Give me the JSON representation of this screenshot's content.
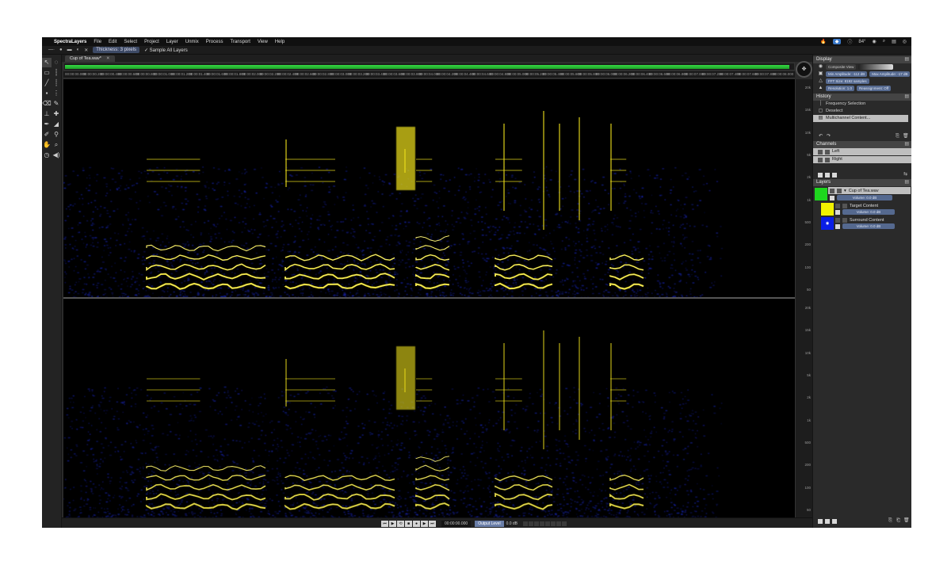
{
  "menubar": {
    "app_name": "SpectraLayers",
    "items": [
      "File",
      "Edit",
      "Select",
      "Project",
      "Layer",
      "Unmix",
      "Process",
      "Transport",
      "View",
      "Help"
    ],
    "tray_value": "84°"
  },
  "optbar": {
    "thickness_label": "Thickness: 3 pixels",
    "sample_all_label": "Sample All Layers"
  },
  "document": {
    "tab_label": "Cup of Tea.wav*",
    "overview_fraction": 0.995
  },
  "ruler": {
    "ticks": [
      "00:00:00.000",
      "00:00:00.200",
      "00:00:00.400",
      "00:00:00.600",
      "00:00:00.800",
      "00:00:01.000",
      "00:00:01.200",
      "00:00:01.400",
      "00:00:01.600",
      "00:00:01.800",
      "00:00:02.000",
      "00:00:02.200",
      "00:00:02.400",
      "00:00:02.600",
      "00:00:02.800",
      "00:00:03.000",
      "00:00:03.200",
      "00:00:03.400",
      "00:00:03.600",
      "00:00:03.800",
      "00:00:04.000",
      "00:00:04.200",
      "00:00:04.400",
      "00:00:04.600",
      "00:00:04.800",
      "00:00:05.000",
      "00:00:05.200",
      "00:00:05.400",
      "00:00:05.600",
      "00:00:05.800",
      "00:00:06.000",
      "00:00:06.200",
      "00:00:06.400",
      "00:00:06.600",
      "00:00:06.800",
      "00:00:07.000",
      "00:00:07.200",
      "00:00:07.400",
      "00:00:07.600",
      "00:00:07.800",
      "00:00:08.000"
    ]
  },
  "freqscale": {
    "top_labels": [
      "20k",
      "15k",
      "10k",
      "5k",
      "2k",
      "1k",
      "500",
      "200",
      "100",
      "50"
    ],
    "bottom_labels": [
      "20k",
      "15k",
      "10k",
      "5k",
      "2k",
      "1k",
      "500",
      "200",
      "100",
      "50"
    ]
  },
  "transport": {
    "buttons": [
      "⏮",
      "▶",
      "⟲",
      "■",
      "●",
      "▶",
      "⏭"
    ],
    "time": "00:00:00.000",
    "output_label": "Output Level",
    "output_db": "0.0 dB"
  },
  "panels": {
    "display": {
      "title": "Display",
      "composite_view": "Composite View",
      "min_amp": "Min Amplitude: -112 dB",
      "max_amp": "Max Amplitude: -17 dB",
      "fft": "FFT Size: 8192 samples",
      "resolution": "Resolution: 1.0",
      "reassign": "Reassignment: Off"
    },
    "history": {
      "title": "History",
      "items": [
        "Frequency Selection",
        "Deselect",
        "Multichannel Content..."
      ]
    },
    "channels": {
      "title": "Channels",
      "items": [
        "Left",
        "Right"
      ]
    },
    "layers": {
      "title": "Layers",
      "items": [
        {
          "name": "Cup of Tea.wav",
          "volume": "Volume: 0.0 dB",
          "color": "#1ed61e"
        },
        {
          "name": "Target Content",
          "volume": "Volume: 0.0 dB",
          "color": "#f2f200"
        },
        {
          "name": "Surround Content",
          "volume": "Volume: 0.0 dB",
          "color": "#0a1ee6"
        }
      ]
    }
  },
  "colors": {
    "spectral_low": "#1a28c8",
    "spectral_high": "#f0e21c",
    "overview": "#35d843"
  }
}
